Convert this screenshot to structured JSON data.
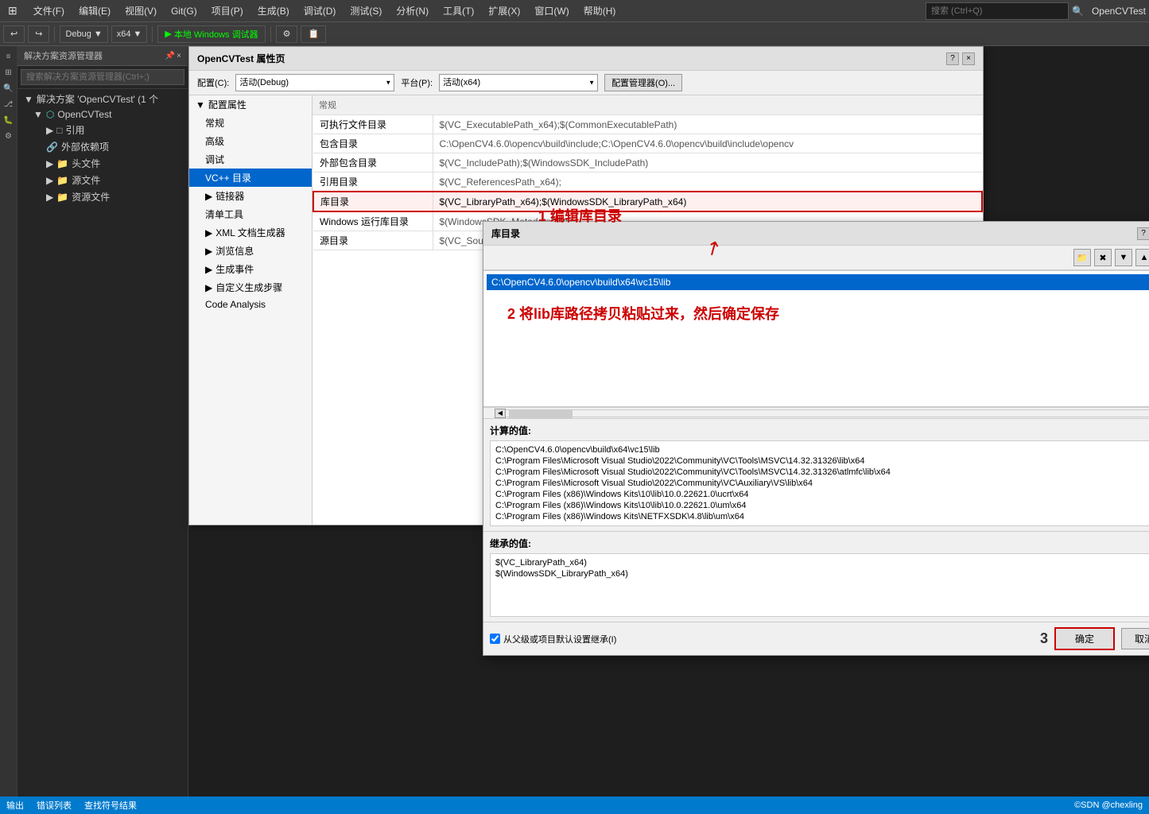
{
  "app": {
    "title": "OpenCVTest",
    "menu_items": [
      "文件(F)",
      "编辑(E)",
      "视图(V)",
      "Git(G)",
      "项目(P)",
      "生成(B)",
      "调试(D)",
      "测试(S)",
      "分析(N)",
      "工具(T)",
      "扩展(X)",
      "窗口(W)",
      "帮助(H)"
    ],
    "search_placeholder": "搜索 (Ctrl+Q)",
    "toolbar": {
      "debug_config": "Debug",
      "platform": "x64",
      "run_label": "本地 Windows 调试器"
    }
  },
  "sidebar": {
    "title": "解决方案资源管理器",
    "search_placeholder": "搜索解决方案资源管理器(Ctrl+;)",
    "tree": {
      "solution_label": "解决方案 'OpenCVTest' (1 个",
      "project_label": "OpenCVTest",
      "ref_label": "引用",
      "extern_label": "外部依赖项",
      "header_label": "头文件",
      "source_label": "源文件",
      "resource_label": "资源文件"
    }
  },
  "properties_dialog": {
    "title": "OpenCVTest 属性页",
    "config_label": "配置(C):",
    "config_value": "活动(Debug)",
    "platform_label": "平台(P):",
    "platform_value": "活动(x64)",
    "manage_btn": "配置管理器(O)...",
    "left_panel": {
      "categories": [
        {
          "label": "▲ 配置属性",
          "expanded": true
        },
        {
          "label": "常规",
          "indent": 1
        },
        {
          "label": "高级",
          "indent": 1
        },
        {
          "label": "调试",
          "indent": 1
        },
        {
          "label": "VC++ 目录",
          "indent": 1,
          "selected": true
        },
        {
          "label": "▲ 链接器",
          "indent": 1
        },
        {
          "label": "清单工具",
          "indent": 1
        },
        {
          "label": "▲ XML 文档生成器",
          "indent": 1
        },
        {
          "label": "▲ 浏览信息",
          "indent": 1
        },
        {
          "label": "▲ 生成事件",
          "indent": 1
        },
        {
          "label": "▲ 自定义生成步骤",
          "indent": 1
        },
        {
          "label": "Code Analysis",
          "indent": 1
        }
      ]
    },
    "right_panel": {
      "section": "常规",
      "rows": [
        {
          "label": "可执行文件目录",
          "value": "$(VC_ExecutablePath_x64);$(CommonExecutablePath)"
        },
        {
          "label": "包含目录",
          "value": "C:\\OpenCV4.6.0\\opencv\\build\\include;C:\\OpenCV4.6.0\\opencv\\build\\include\\opencv"
        },
        {
          "label": "外部包含目录",
          "value": "$(VC_IncludePath);$(WindowsSDK_IncludePath)"
        },
        {
          "label": "引用目录",
          "value": "$(VC_ReferencesPath_x64);"
        },
        {
          "label": "库目录",
          "value": "$(VC_LibraryPath_x64);$(WindowsSDK_LibraryPath_x64)",
          "highlight": true
        },
        {
          "label": "Windows 运行库目录",
          "value": "$(WindowsSDK_MetadataPath);"
        },
        {
          "label": "源目录",
          "value": "$(VC_SourcePath);"
        }
      ]
    }
  },
  "libdir_dialog": {
    "title": "库目录",
    "tools": [
      "folder-icon",
      "delete-icon",
      "down-icon",
      "up-icon"
    ],
    "entries": [
      {
        "value": "C:\\OpenCV4.6.0\\opencv\\build\\x64\\vc15\\lib",
        "selected": true
      }
    ],
    "computed_label": "计算的值:",
    "computed_lines": [
      "C:\\OpenCV4.6.0\\opencv\\build\\x64\\vc15\\lib",
      "C:\\Program Files\\Microsoft Visual Studio\\2022\\Community\\VC\\Tools\\MSVC\\14.32.31326\\lib\\x64",
      "C:\\Program Files\\Microsoft Visual Studio\\2022\\Community\\VC\\Tools\\MSVC\\14.32.31326\\atlmfc\\lib\\x64",
      "C:\\Program Files\\Microsoft Visual Studio\\2022\\Community\\VC\\Auxiliary\\VS\\lib\\x64",
      "C:\\Program Files (x86)\\Windows Kits\\10\\lib\\10.0.22621.0\\ucrt\\x64",
      "C:\\Program Files (x86)\\Windows Kits\\10\\lib\\10.0.22621.0\\um\\x64",
      "C:\\Program Files (x86)\\Windows Kits\\NETFXSDK\\4.8\\lib\\um\\x64"
    ],
    "inherited_label": "继承的值:",
    "inherited_lines": [
      "$(VC_LibraryPath_x64)",
      "$(WindowsSDK_LibraryPath_x64)"
    ],
    "footer_checkbox": "从父级或项目默认设置继承(I)",
    "number_annotation": "3",
    "ok_btn": "确定",
    "cancel_btn": "取消"
  },
  "annotations": {
    "annotation1_text": "1 编辑库目录",
    "annotation2_text": "2 将lib库路径拷贝粘贴过来，然后确定保存"
  },
  "status_bar": {
    "items": [
      "输出",
      "错误列表",
      "查找符号结果"
    ]
  }
}
